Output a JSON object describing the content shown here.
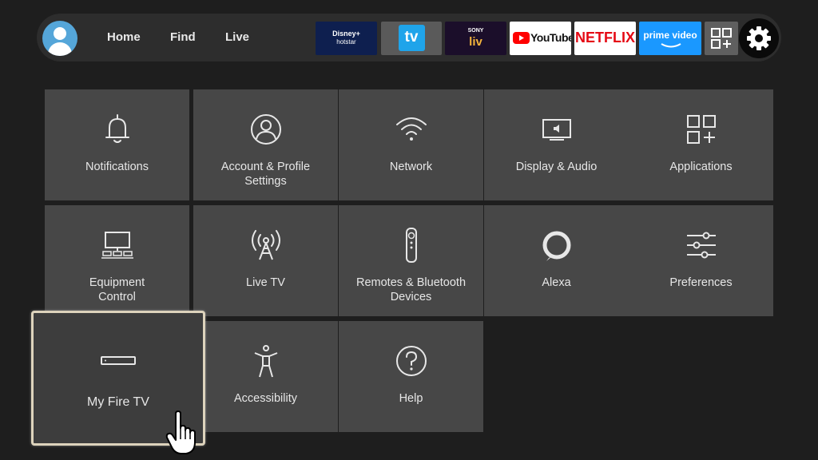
{
  "nav": {
    "home": "Home",
    "find": "Find",
    "live": "Live"
  },
  "apps": {
    "hotstar": {
      "line1": "Disney+",
      "line2": "hotstar"
    },
    "tv": "tv",
    "sonyliv": {
      "line1": "SONY",
      "line2": "liv"
    },
    "youtube": "YouTube",
    "netflix": "NETFLIX",
    "prime": "prime video"
  },
  "tiles": {
    "notifications": "Notifications",
    "account_line1": "Account & Profile",
    "account_line2": "Settings",
    "network": "Network",
    "display_audio": "Display & Audio",
    "applications": "Applications",
    "equipment_line1": "Equipment",
    "equipment_line2": "Control",
    "live_tv": "Live TV",
    "remotes_line1": "Remotes & Bluetooth",
    "remotes_line2": "Devices",
    "alexa": "Alexa",
    "preferences": "Preferences",
    "my_fire_tv": "My Fire TV",
    "accessibility": "Accessibility",
    "help": "Help"
  },
  "colors": {
    "tile_bg": "#474747",
    "background": "#1e1e1e",
    "selected_border": "#ddd3bc",
    "netflix_red": "#e50914",
    "prime_blue": "#1a98ff"
  }
}
